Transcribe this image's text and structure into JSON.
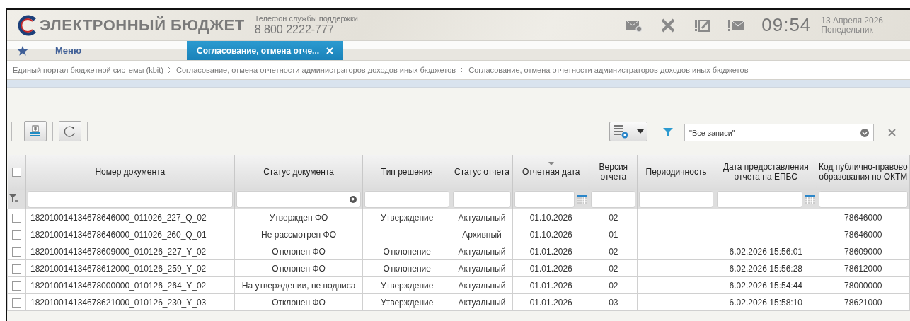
{
  "header": {
    "logo_text": "ЭЛЕКТРОННЫЙ БЮДЖЕТ",
    "support_label": "Телефон службы поддержки",
    "phone": "8 800 2222-777",
    "time": "09:54",
    "date": "13 Апреля 2026",
    "weekday": "Понедельник"
  },
  "tabs": [
    {
      "kind": "menu",
      "label": "Меню",
      "selected": false
    },
    {
      "kind": "document",
      "label": "Согласование, отмена отче...",
      "selected": true
    }
  ],
  "breadcrumb": [
    "Единый портал бюджетной системы (kbit)",
    "Согласование, отмена отчетности администраторов доходов иных бюджетов",
    "Согласование, отмена отчетности администраторов доходов иных бюджетов"
  ],
  "toolbar": {
    "filter_value": "\"Все записи\""
  },
  "table": {
    "select_all_checked": false,
    "columns": [
      {
        "label": "Номер документа",
        "kind": "text",
        "sorted": false
      },
      {
        "label": "Статус документа",
        "kind": "search",
        "sorted": false
      },
      {
        "label": "Тип решения",
        "kind": "text",
        "sorted": false
      },
      {
        "label": "Статус отчета",
        "kind": "text",
        "sorted": false
      },
      {
        "label": "Отчетная дата",
        "kind": "date",
        "sorted": true
      },
      {
        "label": "Версия отчета",
        "kind": "text",
        "sorted": false
      },
      {
        "label": "Периодичность",
        "kind": "text",
        "sorted": false
      },
      {
        "label": "Дата предоставления отчета на ЕПБС",
        "kind": "date",
        "sorted": false
      },
      {
        "label": "Код публично-правово образования по ОКТМ",
        "kind": "text",
        "sorted": false
      }
    ],
    "rows": [
      {
        "checked": false,
        "cells": [
          "182010014134678646000_011026_227_Q_02",
          "Утвержден ФО",
          "Утверждение",
          "Актуальный",
          "01.10.2026",
          "02",
          "",
          "",
          "78646000"
        ]
      },
      {
        "checked": false,
        "cells": [
          "182010014134678646000_011026_260_Q_01",
          "Не рассмотрен ФО",
          "",
          "Архивный",
          "01.10.2026",
          "01",
          "",
          "",
          "78646000"
        ]
      },
      {
        "checked": false,
        "cells": [
          "182010014134678609000_010126_227_Y_02",
          "Отклонен ФО",
          "Отклонение",
          "Актуальный",
          "01.01.2026",
          "02",
          "",
          "6.02.2026 15:56:01",
          "78609000"
        ]
      },
      {
        "checked": false,
        "cells": [
          "182010014134678612000_010126_259_Y_02",
          "Отклонен ФО",
          "Отклонение",
          "Актуальный",
          "01.01.2026",
          "02",
          "",
          "6.02.2026 15:56:28",
          "78612000"
        ]
      },
      {
        "checked": false,
        "cells": [
          "182010014134678000000_010126_264_Y_02",
          "На утверждении, не подписа",
          "Утверждение",
          "Актуальный",
          "01.01.2026",
          "02",
          "",
          "6.02.2026 15:54:44",
          "78000000"
        ]
      },
      {
        "checked": false,
        "cells": [
          "182010014134678621000_010126_230_Y_03",
          "Отклонен ФО",
          "Утверждение",
          "Актуальный",
          "01.01.2026",
          "03",
          "",
          "6.02.2026 15:58:10",
          "78621000"
        ]
      }
    ]
  }
}
